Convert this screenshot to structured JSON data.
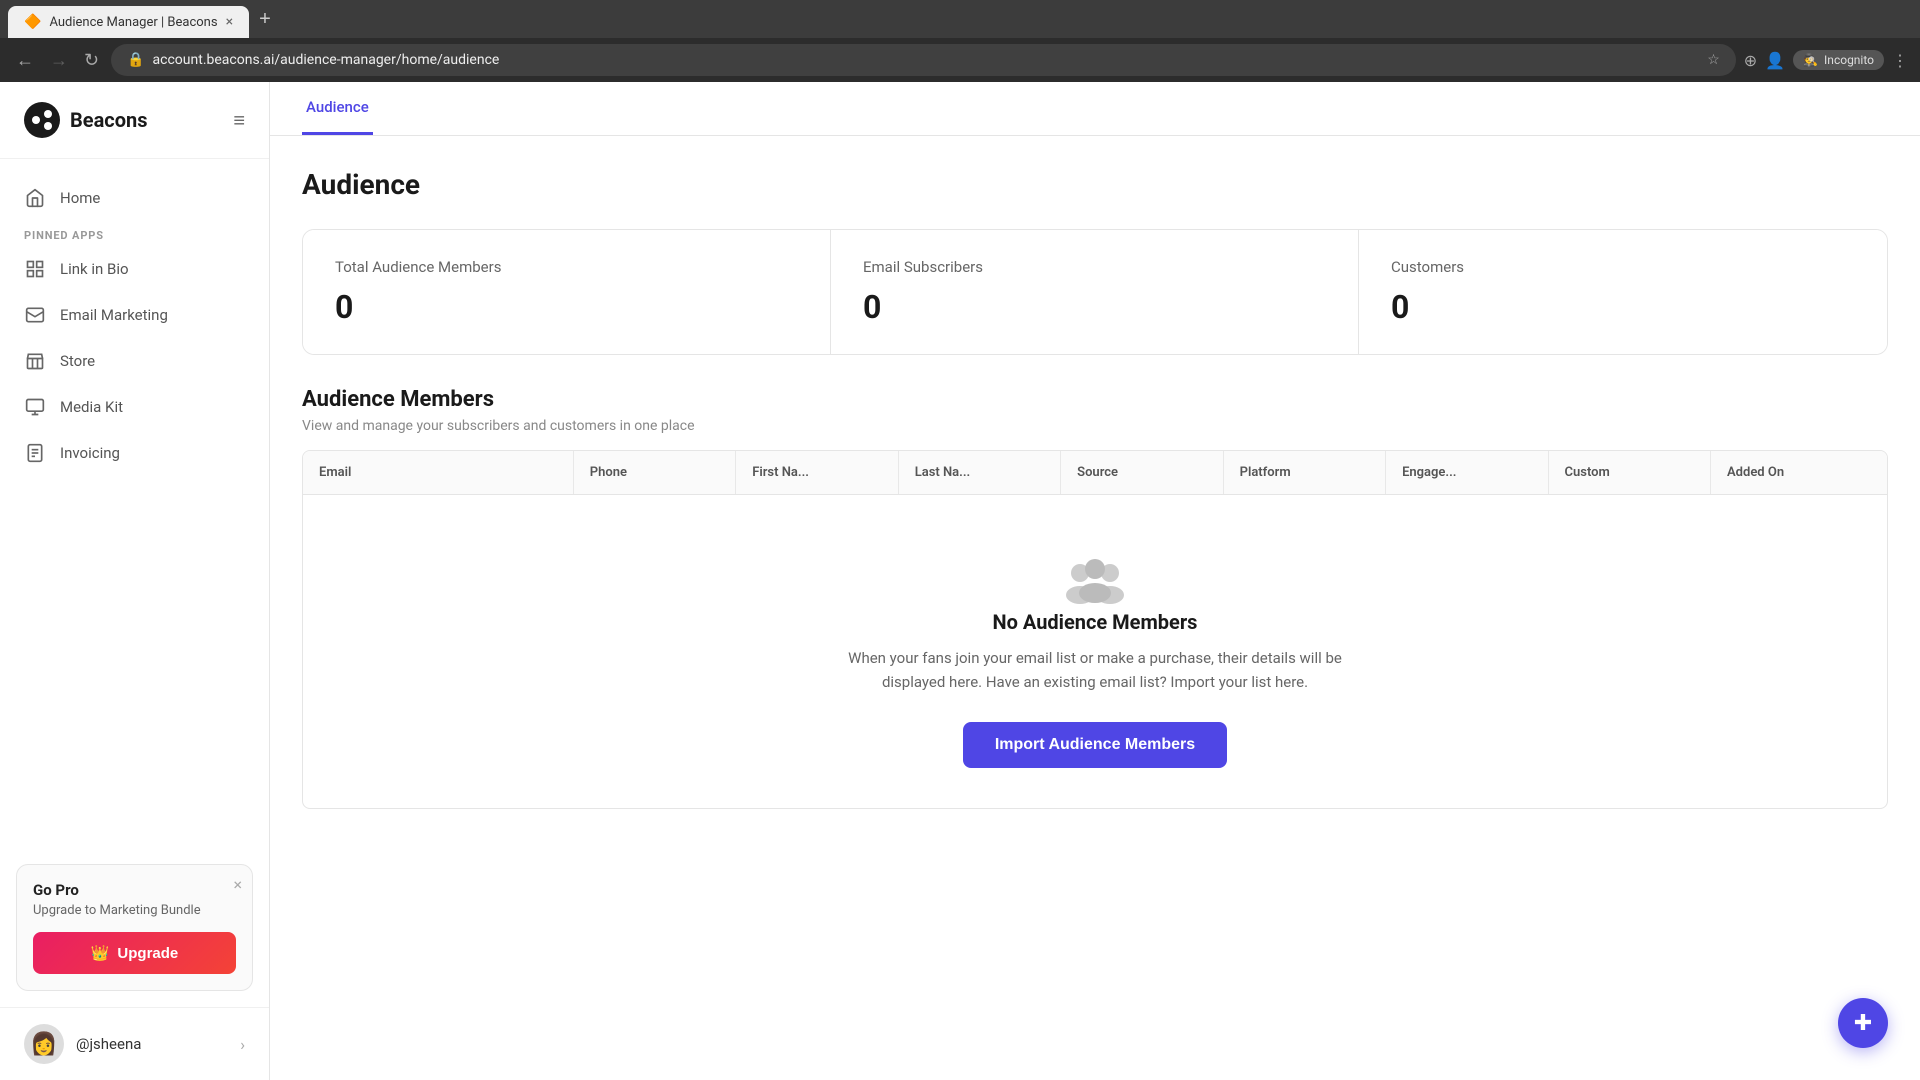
{
  "browser": {
    "tab_favicon": "🔶",
    "tab_title": "Audience Manager | Beacons",
    "tab_close": "×",
    "new_tab": "+",
    "address": "account.beacons.ai/audience-manager/home/audience",
    "incognito_label": "Incognito",
    "nav_back": "←",
    "nav_forward": "→",
    "nav_refresh": "↻"
  },
  "app": {
    "logo_text": "Beacons",
    "menu_icon": "≡"
  },
  "sidebar": {
    "section_label": "PINNED APPS",
    "nav_items": [
      {
        "label": "Home",
        "icon": "home"
      },
      {
        "label": "Link in Bio",
        "icon": "grid"
      },
      {
        "label": "Email Marketing",
        "icon": "mail"
      },
      {
        "label": "Store",
        "icon": "store"
      },
      {
        "label": "Media Kit",
        "icon": "mediakit"
      },
      {
        "label": "Invoicing",
        "icon": "invoice"
      }
    ],
    "go_pro": {
      "close": "×",
      "title": "Go Pro",
      "subtitle": "Upgrade to Marketing Bundle",
      "upgrade_label": "Upgrade",
      "upgrade_crown": "👑"
    },
    "user": {
      "name": "@jsheena",
      "avatar_emoji": "👩",
      "chevron": "›"
    }
  },
  "tabs": [
    {
      "label": "Audience",
      "active": true
    }
  ],
  "content": {
    "page_title": "Audience",
    "stats": [
      {
        "label": "Total Audience Members",
        "value": "0"
      },
      {
        "label": "Email Subscribers",
        "value": "0"
      },
      {
        "label": "Customers",
        "value": "0"
      }
    ],
    "section_title": "Audience Members",
    "section_subtitle": "View and manage your subscribers and customers in one place",
    "table_columns": [
      "Email",
      "Phone",
      "First Na...",
      "Last Na...",
      "Source",
      "Platform",
      "Engage...",
      "Custom",
      "Added On"
    ],
    "empty_state": {
      "title": "No Audience Members",
      "description": "When your fans join your email list or make a purchase, their details will be displayed here. Have an existing email list? Import your list here.",
      "import_label": "Import Audience Members"
    }
  }
}
